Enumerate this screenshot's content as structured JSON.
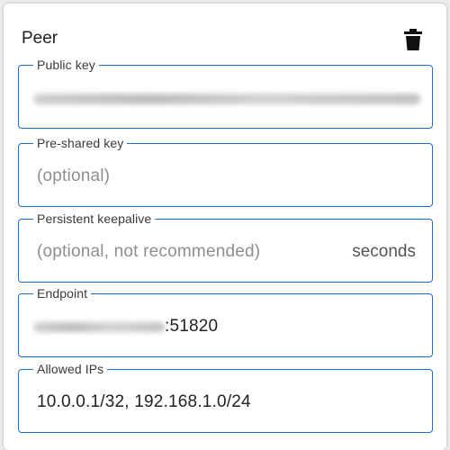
{
  "peer": {
    "title": "Peer",
    "delete_icon": "trash-icon",
    "fields": {
      "public_key": {
        "label": "Public key",
        "value": ""
      },
      "preshared_key": {
        "label": "Pre-shared key",
        "placeholder": "(optional)",
        "value": ""
      },
      "persistent_keepalive": {
        "label": "Persistent keepalive",
        "placeholder": "(optional, not recommended)",
        "suffix": "seconds",
        "value": ""
      },
      "endpoint": {
        "label": "Endpoint",
        "port": ":51820"
      },
      "allowed_ips": {
        "label": "Allowed IPs",
        "value": "10.0.0.1/32, 192.168.1.0/24"
      }
    }
  },
  "colors": {
    "accent": "#1f6fd1",
    "background": "#ffffff",
    "text": "#222222",
    "placeholder": "#8e8e8e"
  }
}
